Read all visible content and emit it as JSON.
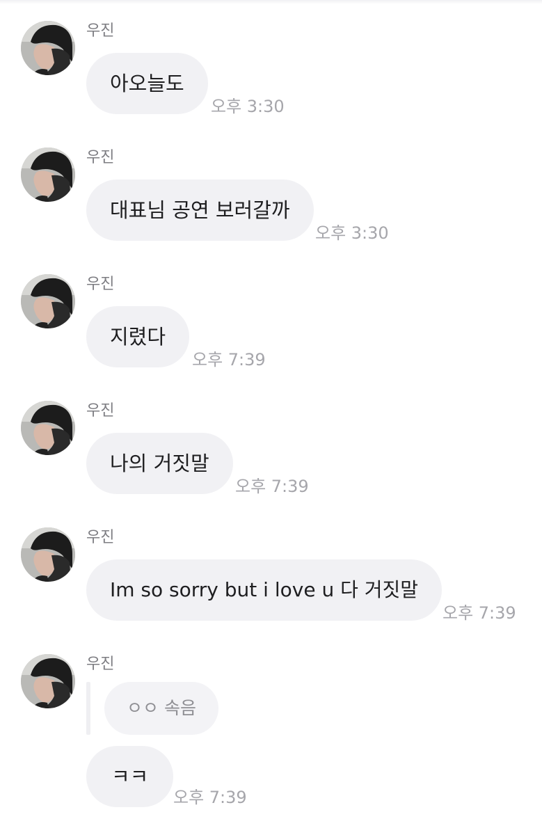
{
  "chat": {
    "messages": [
      {
        "sender": "우진",
        "text": "아오늘도",
        "time": "오후 3:30"
      },
      {
        "sender": "우진",
        "text": "대표님 공연 보러갈까",
        "time": "오후 3:30"
      },
      {
        "sender": "우진",
        "text": "지렸다",
        "time": "오후 7:39"
      },
      {
        "sender": "우진",
        "text": "나의 거짓말",
        "time": "오후 7:39"
      },
      {
        "sender": "우진",
        "text": "Im so sorry but i love u 다 거짓말",
        "time": "오후 7:39"
      },
      {
        "sender": "우진",
        "reply_quote": "ㅇㅇ 속음",
        "text": "ㅋㅋ",
        "time": "오후 7:39"
      }
    ]
  },
  "colors": {
    "bubble_bg": "#f1f1f4",
    "sender_text": "#7d7d82",
    "time_text": "#a6a6ab"
  }
}
